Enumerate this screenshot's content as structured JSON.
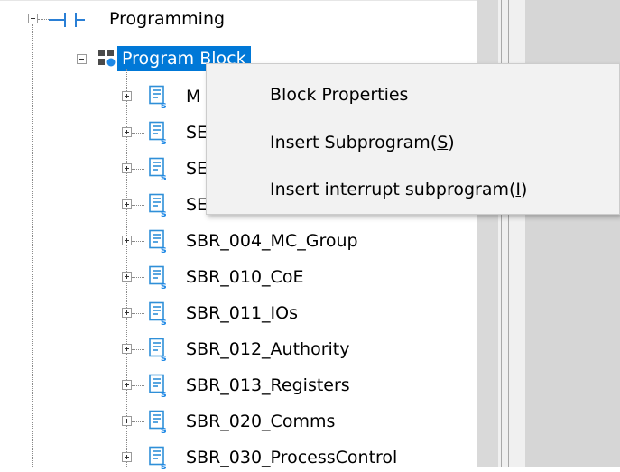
{
  "tree": {
    "root_label": "Programming",
    "program_block_label": "Program Block",
    "items": [
      {
        "label": "M"
      },
      {
        "label": "SE"
      },
      {
        "label": "SE"
      },
      {
        "label": "SE"
      },
      {
        "label": "SBR_004_MC_Group"
      },
      {
        "label": "SBR_010_CoE"
      },
      {
        "label": "SBR_011_IOs"
      },
      {
        "label": "SBR_012_Authority"
      },
      {
        "label": "SBR_013_Registers"
      },
      {
        "label": "SBR_020_Comms"
      },
      {
        "label": "SBR_030_ProcessControl"
      }
    ]
  },
  "context_menu": {
    "block_properties": "Block Properties",
    "insert_subprogram": {
      "text": "Insert Subprogram(",
      "accel": "S",
      "close": ")"
    },
    "insert_interrupt": {
      "text": "Insert interrupt subprogram(",
      "accel": "I",
      "close": ")"
    }
  },
  "icons": {
    "subroutine": "subroutine-doc-icon",
    "program_block": "program-block-icon",
    "ladder": "ladder-contact-icon"
  },
  "colors": {
    "selection": "#0078d7",
    "menu_background": "#f2f2f2"
  }
}
